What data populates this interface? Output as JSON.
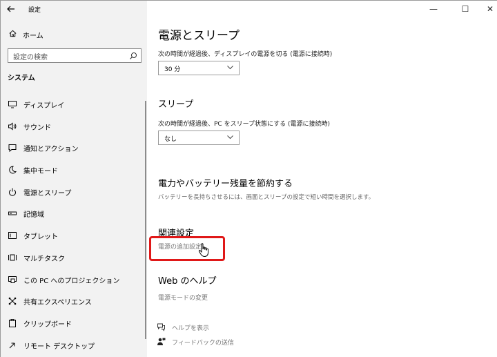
{
  "window": {
    "app_title": "設定",
    "controls": {
      "minimize": "—",
      "maximize": "☐",
      "close": "✕"
    }
  },
  "sidebar": {
    "home_label": "ホーム",
    "search_placeholder": "設定の検索",
    "section_title": "システム",
    "items": [
      {
        "label": "ディスプレイ",
        "icon": "display-icon"
      },
      {
        "label": "サウンド",
        "icon": "sound-icon"
      },
      {
        "label": "通知とアクション",
        "icon": "notification-icon"
      },
      {
        "label": "集中モード",
        "icon": "focus-moon-icon"
      },
      {
        "label": "電源とスリープ",
        "icon": "power-icon"
      },
      {
        "label": "記憶域",
        "icon": "storage-icon"
      },
      {
        "label": "タブレット",
        "icon": "tablet-icon"
      },
      {
        "label": "マルチタスク",
        "icon": "multitask-icon"
      },
      {
        "label": "この PC へのプロジェクション",
        "icon": "projection-icon"
      },
      {
        "label": "共有エクスペリエンス",
        "icon": "shared-experience-icon"
      },
      {
        "label": "クリップボード",
        "icon": "clipboard-icon"
      },
      {
        "label": "リモート デスクトップ",
        "icon": "remote-desktop-icon"
      }
    ]
  },
  "main": {
    "page_title": "電源とスリープ",
    "screen_desc": "次の時間が経過後、ディスプレイの電源を切る (電源に接続時)",
    "screen_value": "30 分",
    "sleep_heading": "スリープ",
    "sleep_desc": "次の時間が経過後、PC をスリープ状態にする (電源に接続時)",
    "sleep_value": "なし",
    "save_heading": "電力やバッテリー残量を節約する",
    "save_desc": "バッテリーを長持ちさせるには、画面とスリープの設定で短い時間を選択します。",
    "related_heading": "関連設定",
    "related_link": "電源の追加設定",
    "web_help_heading": "Web のヘルプ",
    "web_help_link": "電源モードの変更",
    "get_help": "ヘルプを表示",
    "feedback": "フィードバックの送信"
  }
}
